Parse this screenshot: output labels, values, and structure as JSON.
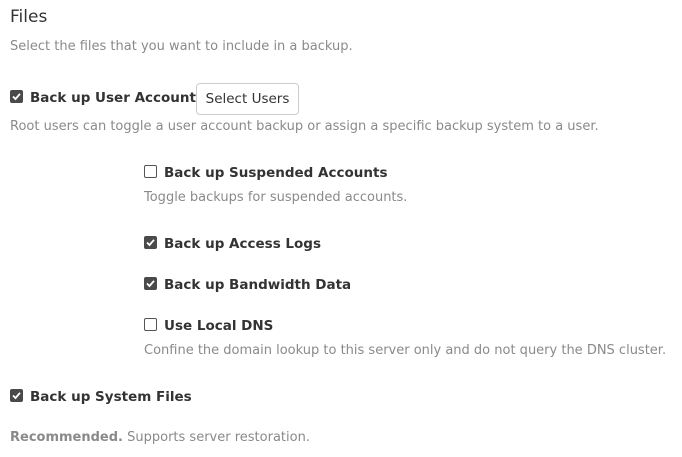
{
  "section": {
    "title": "Files",
    "description": "Select the files that you want to include in a backup."
  },
  "user_accounts": {
    "label": "Back up User Accounts",
    "checked": true,
    "select_button": "Select Users",
    "help": "Root users can toggle a user account backup or assign a specific backup system to a user."
  },
  "suspended_accounts": {
    "label": "Back up Suspended Accounts",
    "checked": false,
    "help": "Toggle backups for suspended accounts."
  },
  "access_logs": {
    "label": "Back up Access Logs",
    "checked": true
  },
  "bandwidth_data": {
    "label": "Back up Bandwidth Data",
    "checked": true
  },
  "local_dns": {
    "label": "Use Local DNS",
    "checked": false,
    "help": "Confine the domain lookup to this server only and do not query the DNS cluster."
  },
  "system_files": {
    "label": "Back up System Files",
    "checked": true,
    "recommended": "Recommended.",
    "help": "Supports server restoration."
  }
}
